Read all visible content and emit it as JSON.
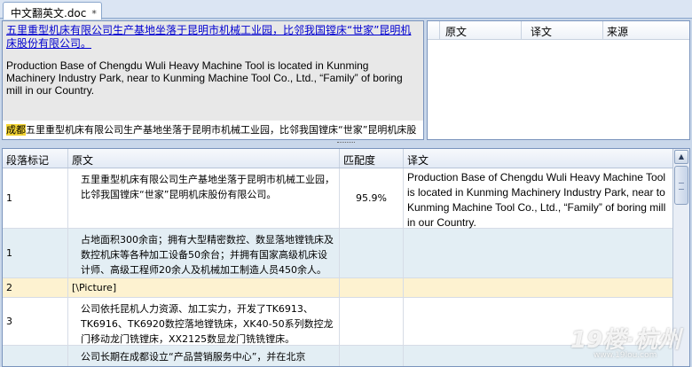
{
  "tab": {
    "title": "中文翻英文.doc",
    "close": "*"
  },
  "document": {
    "current_source": "五里重型机床有限公司生产基地坐落于昆明市机械工业园，比邻我国镗床“世家”昆明机床股份有限公司。",
    "current_translation": "Production Base of Chengdu Wuli Heavy Machine Tool is located in Kunming Machinery Industry Park, near to Kunming Machine Tool Co., Ltd., “Family” of boring mill in our Country.",
    "next_highlight": "成都",
    "next_rest": "五里重型机床有限公司生产基地坐落于昆明市机械工业园，比邻我国镗床“世家”昆明机床股份有限公司。"
  },
  "tm_panel": {
    "headers": [
      "原文",
      "译文",
      "来源"
    ]
  },
  "grid": {
    "headers": [
      "段落标记",
      "原文",
      "匹配度",
      "译文"
    ],
    "rows": [
      {
        "para": "1",
        "source": "五里重型机床有限公司生产基地坐落于昆明市机械工业园，比邻我国镗床“世家”昆明机床股份有限公司。",
        "score": "95.9%",
        "target": "Production Base of Chengdu Wuli Heavy Machine Tool is located in Kunming Machinery Industry Park, near to Kunming Machine Tool Co., Ltd.,  “Family” of boring mill in our Country."
      },
      {
        "para": "1",
        "source": "占地面积300余亩；拥有大型精密数控、数显落地镗铣床及数控机床等各种加工设备50余台；并拥有国家高级机床设计师、高级工程师20余人及机械加工制造人员450余人。",
        "score": "",
        "target": ""
      },
      {
        "para": "2",
        "source": "[\\Picture]",
        "score": "",
        "target": ""
      },
      {
        "para": "3",
        "source": "公司依托昆机人力资源、加工实力，开发了TK6913、TK6916、TK6920数控落地镗铣床，XK40-50系列数控龙门移动龙门铣镗床，XX2125数显龙门铣铣镗床。",
        "score": "",
        "target": ""
      },
      {
        "para": "",
        "source": "公司长期在成都设立“产品营销服务中心”，并在北京",
        "score": "",
        "target": ""
      }
    ]
  },
  "scrollbar": {
    "up_arrow": "▲"
  },
  "watermark": {
    "logo": "19楼·杭州",
    "url": "www.19lou.com"
  }
}
